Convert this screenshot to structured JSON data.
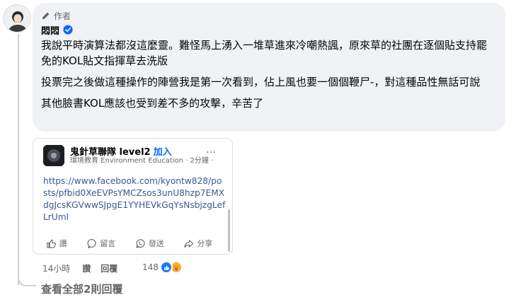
{
  "comment": {
    "author_badge": "作者",
    "author_name": "悶悶",
    "paragraphs": [
      "我說平時演算法都沒這麼靈。難怪馬上湧入一堆草進來冷嘲熱諷，原來草的社團在逐個貼支持罷免的KOL貼文指揮草去洗版",
      "投票完之後做這種操作的陣營我是第一次看到，佔上風也要一個個鞭尸-，對這種品性無話可說",
      "其他臉書KOL應該也受到差不多的攻擊，辛苦了"
    ]
  },
  "shared_post": {
    "group_name": "鬼針草聯隊 level2",
    "join_label": "加入",
    "subtitle": "環境教育 Environment Education · 2分鐘 ·",
    "more_label": "…",
    "link": "https://www.facebook.com/kyontw828/posts/pfbid0XeEVPsYMCZsos3unU8hzp7EMXdgJcsKGVwwSJpgE1YYHEVkGqYsNsbjzgLefLrUml",
    "actions": {
      "like": "讚",
      "comment": "留言",
      "send": "發送",
      "share": "分享"
    }
  },
  "meta": {
    "time": "14小時",
    "like": "讚",
    "reply": "回覆",
    "reaction_count": "148"
  },
  "view_replies": "查看全部2則回覆",
  "colors": {
    "bubble": "#f0f2f5",
    "link": "#385898",
    "accent": "#0866ff",
    "secondary_text": "#65676b"
  }
}
